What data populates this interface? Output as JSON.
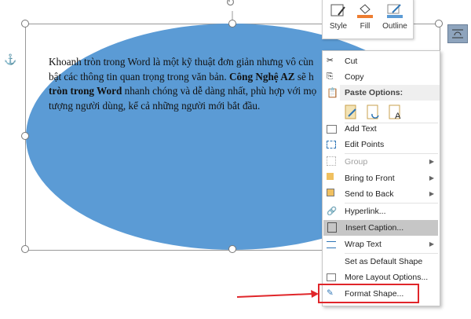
{
  "document": {
    "lines": [
      {
        "normal": "Khoanh tròn trong Word là một kỹ thuật đơn giản nhưng vô cùn"
      },
      {
        "normal": "bật các thông tin quan trọng trong văn bản. ",
        "bold": "Công Nghệ AZ",
        "after": " sẽ h"
      },
      {
        "bold": "tròn trong Word",
        "after": " nhanh chóng và dễ dàng nhất, phù hợp với mọ"
      },
      {
        "normal": "tượng người dùng, kể cả những người mới bắt đầu."
      }
    ]
  },
  "shape": {
    "fill": "#5b9bd5",
    "type": "ellipse"
  },
  "toolbar": {
    "style": "Style",
    "fill": "Fill",
    "outline": "Outline",
    "fill_color": "#ed7d31",
    "outline_color": "#5b9bd5"
  },
  "menu": {
    "cut": "Cut",
    "copy": "Copy",
    "paste_options": "Paste Options:",
    "add_text": "Add Text",
    "edit_points": "Edit Points",
    "group": "Group",
    "bring_to_front": "Bring to Front",
    "send_to_back": "Send to Back",
    "hyperlink": "Hyperlink...",
    "insert_caption": "Insert Caption...",
    "wrap_text": "Wrap Text",
    "set_default": "Set as Default Shape",
    "more_layout": "More Layout Options...",
    "format_shape": "Format Shape..."
  },
  "annotation": {
    "color": "#e0262a"
  }
}
